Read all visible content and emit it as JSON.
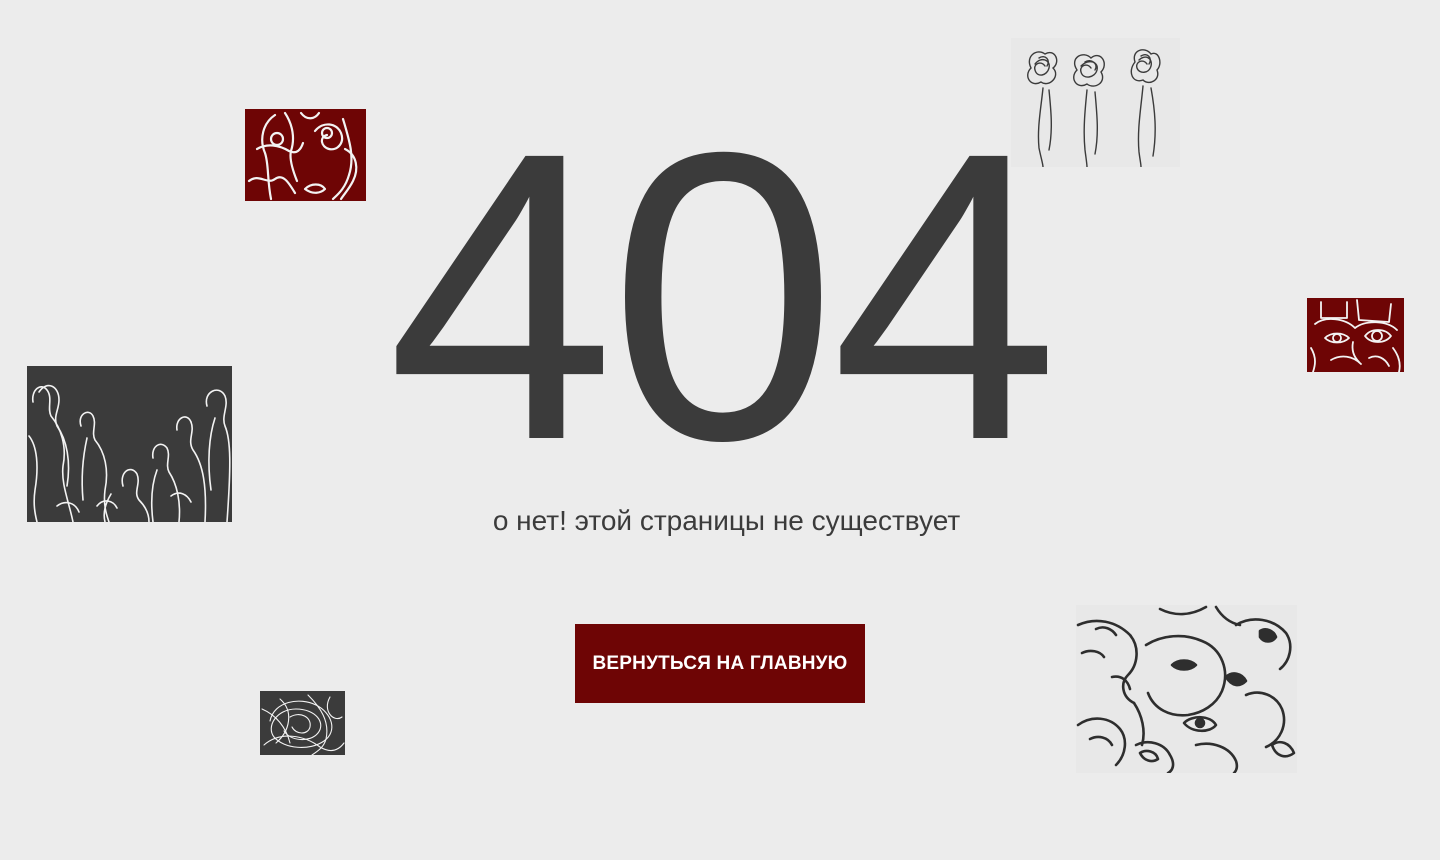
{
  "error": {
    "code": "404",
    "message": "о нет! этой страницы не существует"
  },
  "actions": {
    "home_button_label": "ВЕРНУТЬСЯ НА ГЛАВНУЮ"
  },
  "colors": {
    "background": "#ececec",
    "text": "#3b3b3b",
    "accent": "#6e0505",
    "button_text": "#ffffff"
  },
  "artworks": [
    {
      "name": "red-faces-sketch",
      "tone": "dark-red"
    },
    {
      "name": "three-figures-sketch",
      "tone": "light"
    },
    {
      "name": "red-eye-face-sketch",
      "tone": "dark-red"
    },
    {
      "name": "crowd-figures-sketch",
      "tone": "dark-gray"
    },
    {
      "name": "scribble-sketch",
      "tone": "dark-gray"
    },
    {
      "name": "faces-collage-sketch",
      "tone": "light"
    }
  ]
}
